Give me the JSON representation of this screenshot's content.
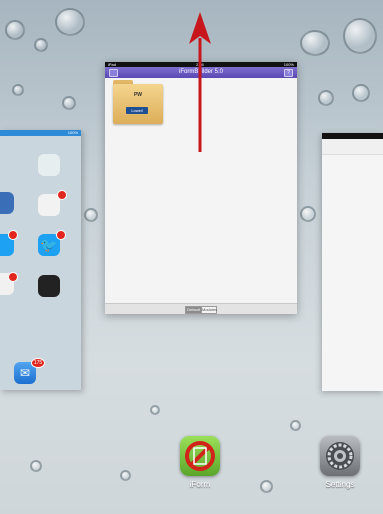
{
  "center_card": {
    "status_left": "iPad",
    "status_time": "2:46",
    "status_right": "100%",
    "nav_title": "iFormBuilder 5.0",
    "nav_right": "?",
    "folder": {
      "name": "PW",
      "badge": "Lowell"
    },
    "segment_active": "Default",
    "segment_inactive": "Modules"
  },
  "left_card": {
    "status_right": "100%",
    "mail_badge": "175"
  },
  "dock": {
    "app1": {
      "label": "iForm",
      "icon": "iform-app-icon"
    },
    "app2": {
      "label": "Settings",
      "icon": "settings-gear-icon"
    }
  },
  "colors": {
    "arrow": "#c8161d",
    "nav_purple": "#6a5ac4",
    "iform_green": "#7bc843"
  }
}
